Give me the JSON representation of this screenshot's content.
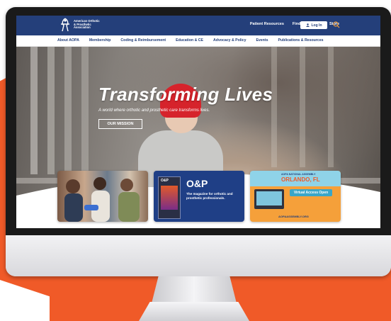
{
  "header": {
    "logo_text": "American Orthotic & Prosthetic Association",
    "utility_nav": [
      "Patient Resources",
      "Find a Provider",
      "Store"
    ],
    "login_label": "Log In"
  },
  "main_nav": [
    "About AOPA",
    "Membership",
    "Coding & Reimbursement",
    "Education & CE",
    "Advocacy & Policy",
    "Events",
    "Publications & Resources"
  ],
  "hero": {
    "title": "Transforming Lives",
    "subtitle": "A world where orthotic and prosthetic care transforms lives.",
    "button_label": "OUR MISSION"
  },
  "cards": {
    "op": {
      "cover_label": "O&P",
      "logo": "O&P",
      "text": "The magazine for orthotic and prosthetic professionals."
    },
    "assembly": {
      "headline": "AOPA NATIONAL ASSEMBLY",
      "city": "ORLANDO, FL",
      "access_label": "Virtual Access Open",
      "url": "AOPAASSEMBLY.ORG"
    }
  },
  "colors": {
    "brand_navy": "#243f7a",
    "accent_orange": "#f05a28",
    "op_blue": "#1f3f86",
    "assembly_orange": "#f5a03a"
  }
}
